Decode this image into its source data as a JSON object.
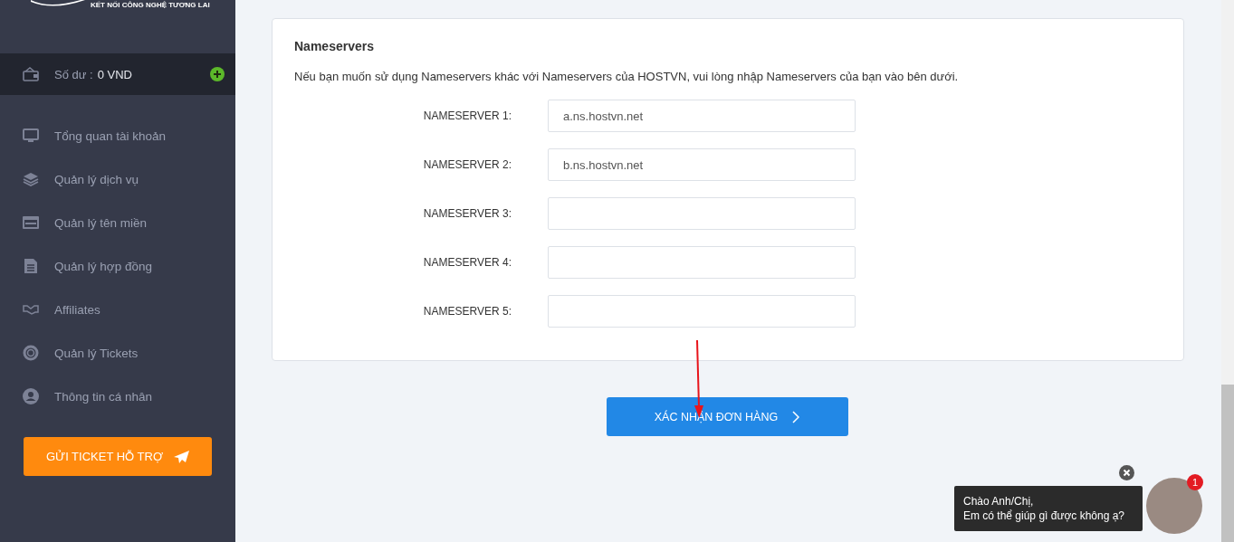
{
  "sidebar": {
    "logo_tagline": "KẾT NỐI CÔNG NGHỆ TƯƠNG LAI",
    "balance": {
      "label": "Số dư :",
      "value": "0 VND"
    },
    "items": [
      {
        "label": "Tổng quan tài khoản"
      },
      {
        "label": "Quản lý dịch vụ"
      },
      {
        "label": "Quản lý tên miền"
      },
      {
        "label": "Quản lý hợp đồng"
      },
      {
        "label": "Affiliates"
      },
      {
        "label": "Quản lý Tickets"
      },
      {
        "label": "Thông tin cá nhân"
      }
    ],
    "support_button": "GỬI TICKET HỖ TRỢ"
  },
  "nameservers": {
    "title": "Nameservers",
    "description": "Nếu bạn muốn sử dụng Nameservers khác với Nameservers của HOSTVN, vui lòng nhập Nameservers của bạn vào bên dưới.",
    "fields": [
      {
        "label": "NAMESERVER 1:",
        "value": "a.ns.hostvn.net"
      },
      {
        "label": "NAMESERVER 2:",
        "value": "b.ns.hostvn.net"
      },
      {
        "label": "NAMESERVER 3:"
      },
      {
        "label": "NAMESERVER 4:"
      },
      {
        "label": "NAMESERVER 5:"
      }
    ]
  },
  "confirm_button": "XÁC NHẬN ĐƠN HÀNG",
  "chat": {
    "message_lines": [
      "Chào Anh/Chị,",
      "Em có thể giúp gì được không ạ?"
    ],
    "badge": "1"
  }
}
